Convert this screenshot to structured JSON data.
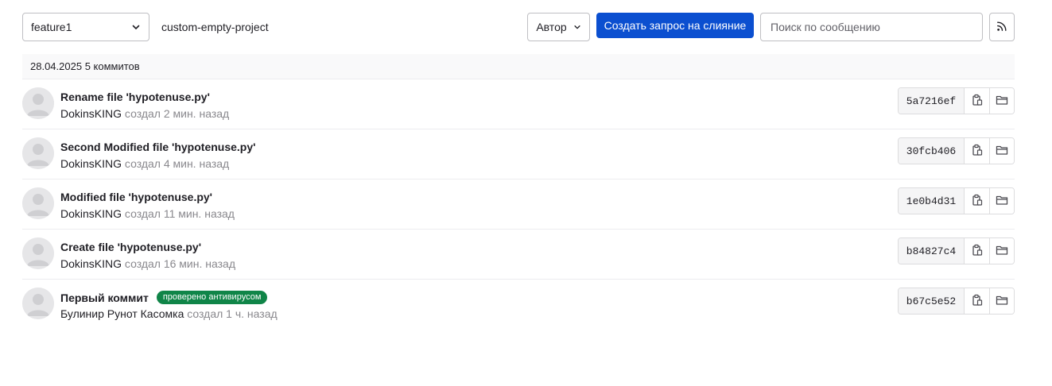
{
  "toolbar": {
    "branch": "feature1",
    "project_path": "custom-empty-project",
    "author_label": "Автор",
    "merge_request_label": "Создать запрос на слияние",
    "search_placeholder": "Поиск по сообщению"
  },
  "day": {
    "date": "28.04.2025",
    "count_label": "5 коммитов"
  },
  "commits": [
    {
      "title": "Rename file 'hypotenuse.py'",
      "author": "DokinsKING",
      "when": "создал 2 мин. назад",
      "sha": "5a7216ef",
      "badge": ""
    },
    {
      "title": "Second Modified file 'hypotenuse.py'",
      "author": "DokinsKING",
      "when": "создал 4 мин. назад",
      "sha": "30fcb406",
      "badge": ""
    },
    {
      "title": "Modified file 'hypotenuse.py'",
      "author": "DokinsKING",
      "when": "создал 11 мин. назад",
      "sha": "1e0b4d31",
      "badge": ""
    },
    {
      "title": "Create file 'hypotenuse.py'",
      "author": "DokinsKING",
      "when": "создал 16 мин. назад",
      "sha": "b84827c4",
      "badge": ""
    },
    {
      "title": "Первый коммит",
      "author": "Булинир Рунот Касомка",
      "when": "создал 1 ч. назад",
      "sha": "b67c5e52",
      "badge": "проверено антивирусом"
    }
  ],
  "colors": {
    "primary": "#0b4fd0",
    "badge_green": "#108548",
    "muted_text": "#89888d"
  },
  "icons": {
    "branch_dropdown": "chevron-down-icon",
    "author_dropdown": "chevron-down-icon",
    "rss": "rss-icon",
    "copy": "copy-icon",
    "browse": "folder-icon",
    "avatar": "default-avatar-icon"
  }
}
